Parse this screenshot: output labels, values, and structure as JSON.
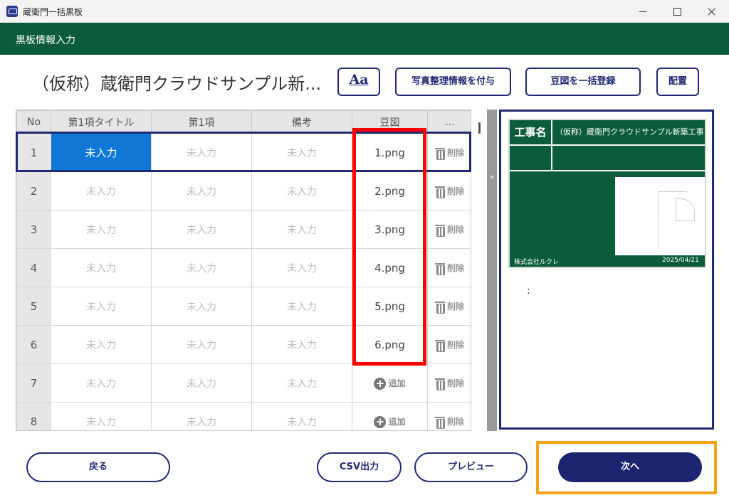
{
  "window": {
    "title": "蔵衛門一括黒板",
    "controls": [
      "minimize",
      "maximize",
      "close"
    ]
  },
  "header": {
    "title": "黒板情報入力"
  },
  "project": {
    "title": "（仮称）蔵衛門クラウドサンプル新..."
  },
  "toolbar": {
    "font_label": "Aa",
    "photo_info_label": "写真整理情報を付与",
    "bulk_register_label": "豆図を一括登録",
    "layout_label": "配置"
  },
  "table": {
    "columns": [
      "No",
      "第1項タイトル",
      "第1項",
      "備考",
      "豆図",
      "..."
    ],
    "rows": [
      {
        "no": "1",
        "title": "未入力",
        "item": "未入力",
        "note": "未入力",
        "figure": "1.png",
        "delete": "削除"
      },
      {
        "no": "2",
        "title": "未入力",
        "item": "未入力",
        "note": "未入力",
        "figure": "2.png",
        "delete": "削除"
      },
      {
        "no": "3",
        "title": "未入力",
        "item": "未入力",
        "note": "未入力",
        "figure": "3.png",
        "delete": "削除"
      },
      {
        "no": "4",
        "title": "未入力",
        "item": "未入力",
        "note": "未入力",
        "figure": "4.png",
        "delete": "削除"
      },
      {
        "no": "5",
        "title": "未入力",
        "item": "未入力",
        "note": "未入力",
        "figure": "5.png",
        "delete": "削除"
      },
      {
        "no": "6",
        "title": "未入力",
        "item": "未入力",
        "note": "未入力",
        "figure": "6.png",
        "delete": "削除"
      },
      {
        "no": "7",
        "title": "未入力",
        "item": "未入力",
        "note": "未入力",
        "add": "追加",
        "delete": "削除"
      },
      {
        "no": "8",
        "title": "未入力",
        "item": "未入力",
        "note": "未入力",
        "add": "追加",
        "delete": "削除"
      }
    ]
  },
  "splitter": {
    "label": "»"
  },
  "preview": {
    "board_label": "工事名",
    "board_value": "（仮称）蔵衛門クラウドサンプル新築工事",
    "company": "株式会社ルクレ",
    "date": "2025/04/21",
    "colon": ":"
  },
  "footer": {
    "back_label": "戻る",
    "csv_label": "CSV出力",
    "preview_label": "プレビュー",
    "next_label": "次へ"
  },
  "colors": {
    "header_green": "#0a5c3b",
    "navy": "#202a72",
    "selected_cell": "#0f78d7",
    "highlight_red": "#ff0000",
    "highlight_orange": "#f5a11c"
  }
}
